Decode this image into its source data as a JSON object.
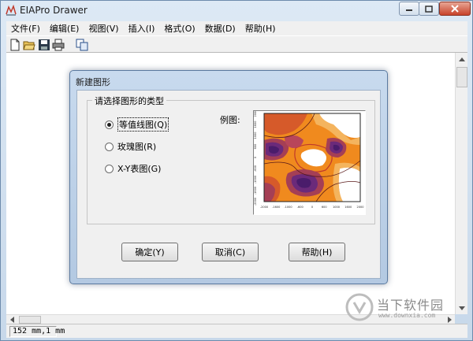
{
  "window": {
    "title": "EIAPro Drawer"
  },
  "menu": [
    "文件(F)",
    "编辑(E)",
    "视图(V)",
    "插入(I)",
    "格式(O)",
    "数据(D)",
    "帮助(H)"
  ],
  "toolbar": {
    "buttons": [
      "new-file-icon",
      "open-folder-icon",
      "save-icon",
      "print-icon",
      "copy-icon"
    ]
  },
  "dialog": {
    "title": "新建图形",
    "group_label": "请选择图形的类型",
    "sample_label": "例图:",
    "options": [
      {
        "label": "等值线图(Q)",
        "checked": true
      },
      {
        "label": "玫瑰图(R)",
        "checked": false
      },
      {
        "label": "X-Y表图(G)",
        "checked": false
      }
    ],
    "preview": {
      "x_ticks": [
        "-2000",
        "-1600",
        "-1000",
        "-600",
        "0",
        "600",
        "1000",
        "1600",
        "2000"
      ],
      "y_ticks": [
        "2000",
        "1600",
        "1000",
        "600",
        "0",
        "-600",
        "-1000",
        "-1600",
        "-2000"
      ]
    },
    "buttons": {
      "ok": "确定(Y)",
      "cancel": "取消(C)",
      "help": "帮助(H)"
    }
  },
  "statusbar": {
    "position": "152 mm,1 mm"
  },
  "watermark": {
    "name": "当下软件园",
    "url": "www.downxia.com"
  }
}
